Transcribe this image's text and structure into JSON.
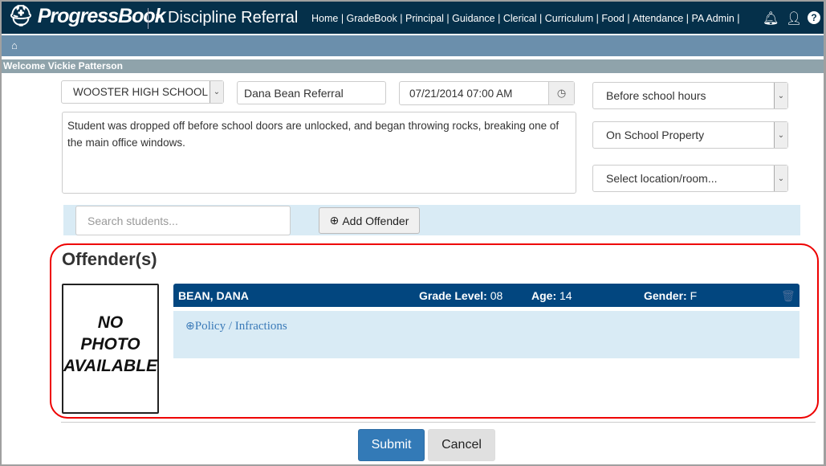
{
  "header": {
    "logo": "ProgressBook",
    "app_title": "Discipline Referral",
    "nav": [
      "Home",
      "GradeBook",
      "Principal",
      "Guidance",
      "Clerical",
      "Curriculum",
      "Food",
      "Attendance",
      "PA Admin"
    ]
  },
  "welcome": "Welcome Vickie Patterson",
  "form": {
    "school": "WOOSTER HIGH SCHOOL",
    "title": "Dana Bean Referral",
    "datetime": "07/21/2014 07:00 AM",
    "description": "Student was dropped off before school doors are unlocked, and began throwing rocks, breaking one of the main office windows.",
    "time_of_day": "Before school hours",
    "location": "On School Property",
    "room": "Select location/room...",
    "search_placeholder": "Search students...",
    "add_offender": "Add Offender"
  },
  "offenders": {
    "heading": "Offender(s)",
    "photo_lines": [
      "NO",
      "PHOTO",
      "AVAILABLE"
    ],
    "name": "BEAN, DANA",
    "grade_label": "Grade Level:",
    "grade": "08",
    "age_label": "Age:",
    "age": "14",
    "gender_label": "Gender:",
    "gender": "F",
    "policy_link": "Policy / Infractions"
  },
  "actions": {
    "submit": "Submit",
    "cancel": "Cancel"
  }
}
